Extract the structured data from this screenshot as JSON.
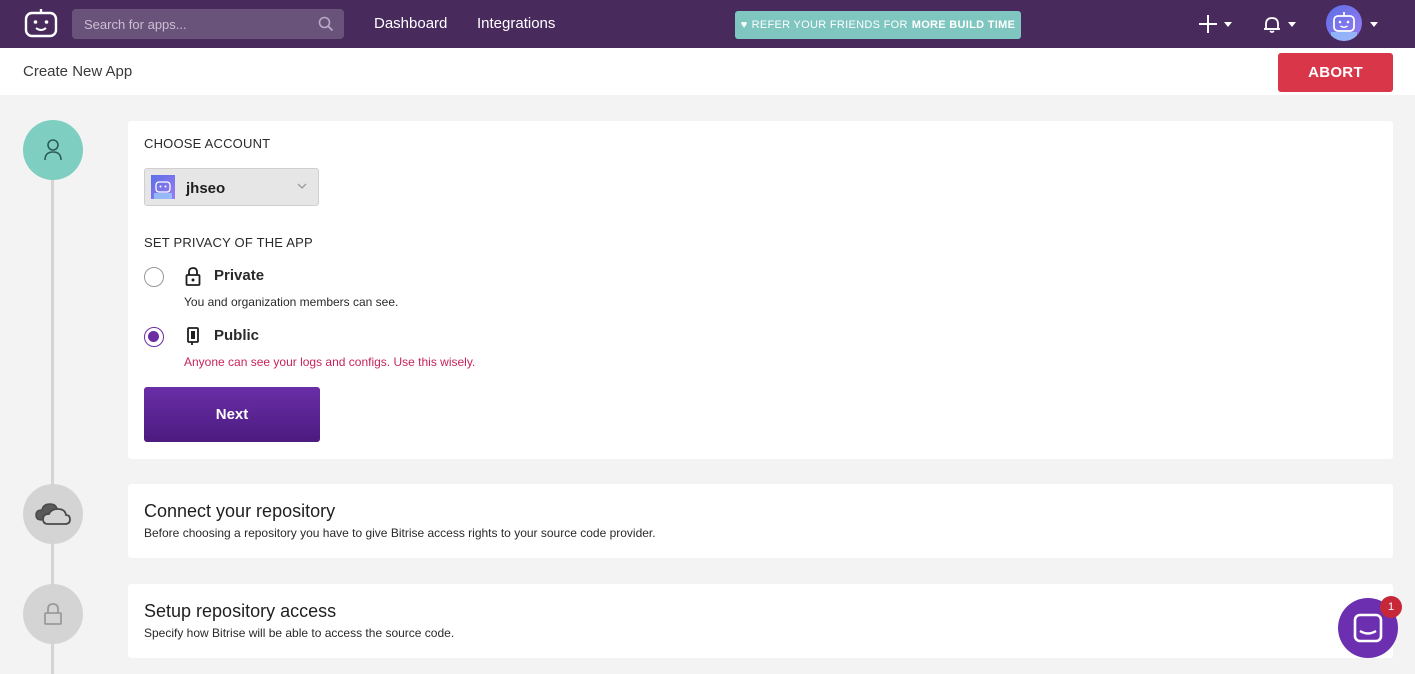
{
  "topbar": {
    "search_placeholder": "Search for apps...",
    "nav": [
      {
        "label": "Dashboard"
      },
      {
        "label": "Integrations"
      }
    ],
    "refer": {
      "prefix": "REFER YOUR FRIENDS FOR",
      "bold": "MORE BUILD TIME"
    }
  },
  "subheader": {
    "title": "Create New App",
    "abort_label": "ABORT"
  },
  "step1": {
    "choose_account_label": "CHOOSE ACCOUNT",
    "account_name": "jhseo",
    "privacy_label": "SET PRIVACY OF THE APP",
    "options": [
      {
        "label": "Private",
        "description": "You and organization members can see.",
        "selected": false
      },
      {
        "label": "Public",
        "description": "Anyone can see your logs and configs. Use this wisely.",
        "selected": true
      }
    ],
    "next_label": "Next"
  },
  "step2": {
    "title": "Connect your repository",
    "description": "Before choosing a repository you have to give Bitrise access rights to your source code provider."
  },
  "step3": {
    "title": "Setup repository access",
    "description": "Specify how Bitrise will be able to access the source code."
  },
  "chat": {
    "badge": "1"
  },
  "colors": {
    "topbar": "#482a5d",
    "accent": "#6b2ea3",
    "abort": "#d9364a",
    "teal": "#7ecfc2",
    "warning_text": "#c7245a"
  }
}
